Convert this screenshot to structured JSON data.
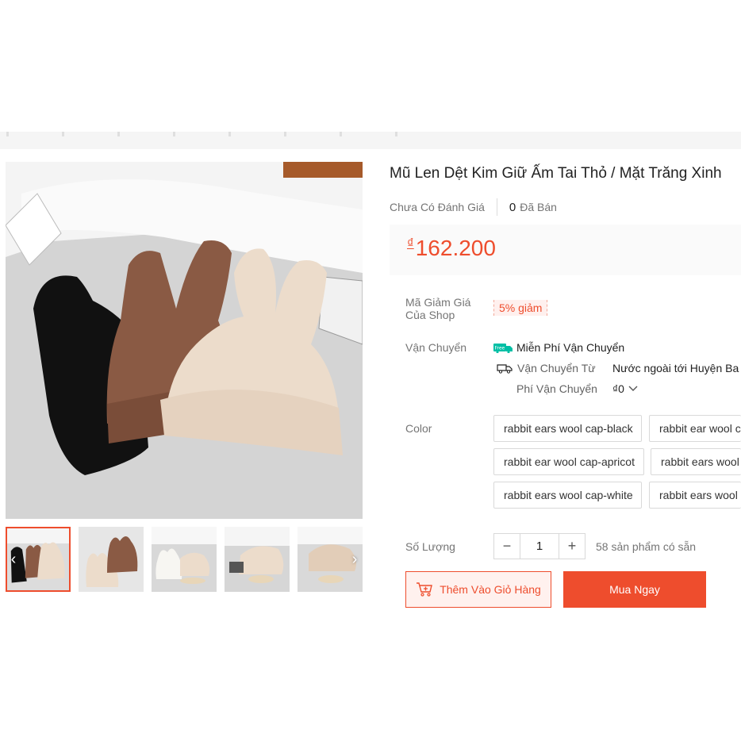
{
  "product": {
    "title": "Mũ Len Dệt Kim Giữ Ấm Tai Thỏ / Mặt Trăng Xinh",
    "rating_text": "Chưa Có Đánh Giá",
    "sold_count": "0",
    "sold_label": "Đã Bán",
    "price_currency": "₫",
    "price": "162.200"
  },
  "voucher": {
    "label": "Mã Giảm Giá Của Shop",
    "value": "5% giảm"
  },
  "shipping": {
    "label": "Vận Chuyển",
    "free_text": "Miễn Phí Vận Chuyển",
    "from_label": "Vận Chuyển Từ",
    "from_value": "Nước ngoài tới Huyện Ba",
    "fee_label": "Phí Vận Chuyển",
    "fee_value": "₫0",
    "free_badge": "Free"
  },
  "variations": {
    "label": "Color",
    "options": [
      "rabbit ears wool cap-black",
      "rabbit ear wool c",
      "rabbit ear wool cap-apricot",
      "rabbit ears wool",
      "rabbit ears wool cap-white",
      "rabbit ears wool"
    ]
  },
  "quantity": {
    "label": "Số Lượng",
    "value": "1",
    "minus": "−",
    "plus": "+",
    "stock_text": "58 sản phẩm có sẵn"
  },
  "actions": {
    "add_to_cart": "Thêm Vào Giỏ Hàng",
    "buy_now": "Mua Ngay"
  },
  "gallery": {
    "prev_arrow": "‹",
    "next_arrow": "›"
  },
  "colors": {
    "accent": "#ee4d2d",
    "hat_black": "#111111",
    "hat_brown": "#8a5a44",
    "hat_beige": "#ecdccb"
  },
  "icons": [
    "chevron-down-icon",
    "truck-icon",
    "free-shipping-icon",
    "add-to-cart-icon"
  ]
}
